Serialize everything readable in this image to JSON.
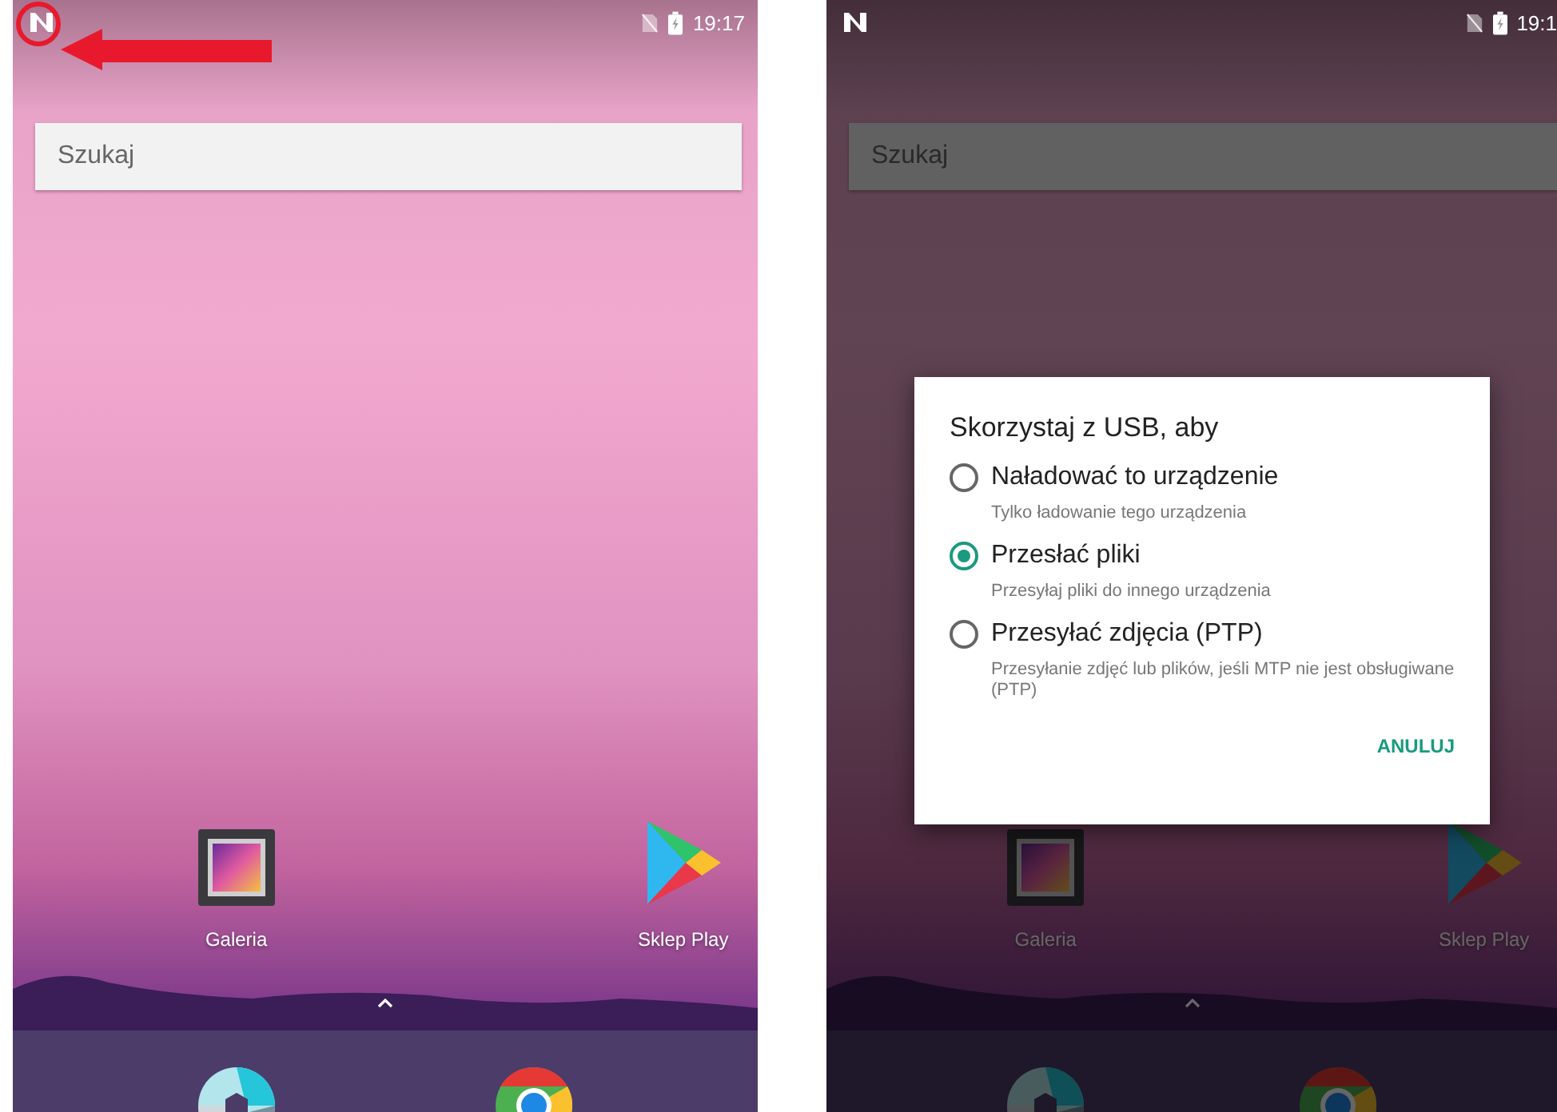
{
  "screens": [
    {
      "dimmed": false,
      "highlight_marker": true,
      "status": {
        "time": "19:17"
      },
      "search": {
        "placeholder": "Szukaj"
      },
      "apps": [
        {
          "kind": "gallery",
          "label": "Galeria"
        },
        {
          "kind": "store",
          "label": "Sklep Play"
        }
      ]
    },
    {
      "dimmed": true,
      "highlight_marker": false,
      "status": {
        "time": "19:1"
      },
      "search": {
        "placeholder": "Szukaj"
      },
      "apps": [
        {
          "kind": "gallery",
          "label": "Galeria"
        },
        {
          "kind": "store",
          "label": "Sklep Play"
        }
      ],
      "dialog": {
        "title": "Skorzystaj z USB, aby",
        "options": [
          {
            "label": "Naładować to urządzenie",
            "description": "Tylko ładowanie tego urządzenia",
            "selected": false
          },
          {
            "label": "Przesłać pliki",
            "description": "Przesyłaj pliki do innego urządzenia",
            "selected": true
          },
          {
            "label": "Przesyłać zdjęcia (PTP)",
            "description": "Przesyłanie zdjęć lub plików, jeśli MTP nie jest obsługiwane (PTP)",
            "selected": false
          }
        ],
        "button": "ANULUJ"
      }
    }
  ]
}
